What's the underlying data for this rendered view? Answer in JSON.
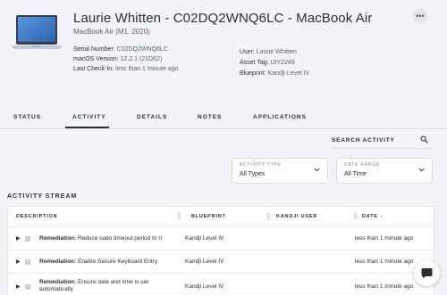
{
  "device": {
    "title": "Laurie Whitten - C02DQ2WNQ6LC - MacBook Air",
    "model": "MacBook Air (M1, 2020)",
    "more_icon": "ellipsis-icon",
    "details_left": [
      {
        "label": "Serial Number:",
        "value": "C02DQ2WNQ6LC"
      },
      {
        "label": "macOS Version:",
        "value": "12.2.1 (21D62)"
      },
      {
        "label": "Last Check-In:",
        "value": "less than 1 minute ago"
      }
    ],
    "details_right": [
      {
        "label": "User:",
        "value": "Laurie Whitten"
      },
      {
        "label": "Asset Tag:",
        "value": "UIY2249"
      },
      {
        "label": "Blueprint:",
        "value": "Kandji Level IV"
      }
    ]
  },
  "tabs": [
    "STATUS",
    "ACTIVITY",
    "DETAILS",
    "NOTES",
    "APPLICATIONS"
  ],
  "active_tab": "ACTIVITY",
  "search": {
    "label": "SEARCH ACTIVITY",
    "icon": "search-icon"
  },
  "filters": [
    {
      "label": "ACTIVITY TYPE",
      "value": "All Types"
    },
    {
      "label": "DATE RANGE",
      "value": "All Time"
    }
  ],
  "stream": {
    "title": "ACTIVITY STREAM",
    "columns": [
      "DESCRIPTION",
      "BLUEPRINT",
      "KANDJI USER",
      "DATE"
    ],
    "sort_indicator": "↓",
    "rows": [
      {
        "type": "Remediation:",
        "text": "Reduce sudo timeout period to 0",
        "blueprint": "Kandji Level IV",
        "user": "",
        "date": "less than 1 minute ago"
      },
      {
        "type": "Remediation:",
        "text": "Enable Secure Keyboard Entry",
        "blueprint": "Kandji Level IV",
        "user": "",
        "date": "less than 1 minute ago"
      },
      {
        "type": "Remediation:",
        "text": "Ensure date and time is set",
        "text2": "automatically",
        "blueprint": "Kandji Level IV",
        "user": "",
        "date": "less than 1 minute ago"
      }
    ]
  },
  "colors": {
    "accent": "#2b2f36",
    "background": "#f3f4f7",
    "row_check": "#c8ccd3"
  }
}
